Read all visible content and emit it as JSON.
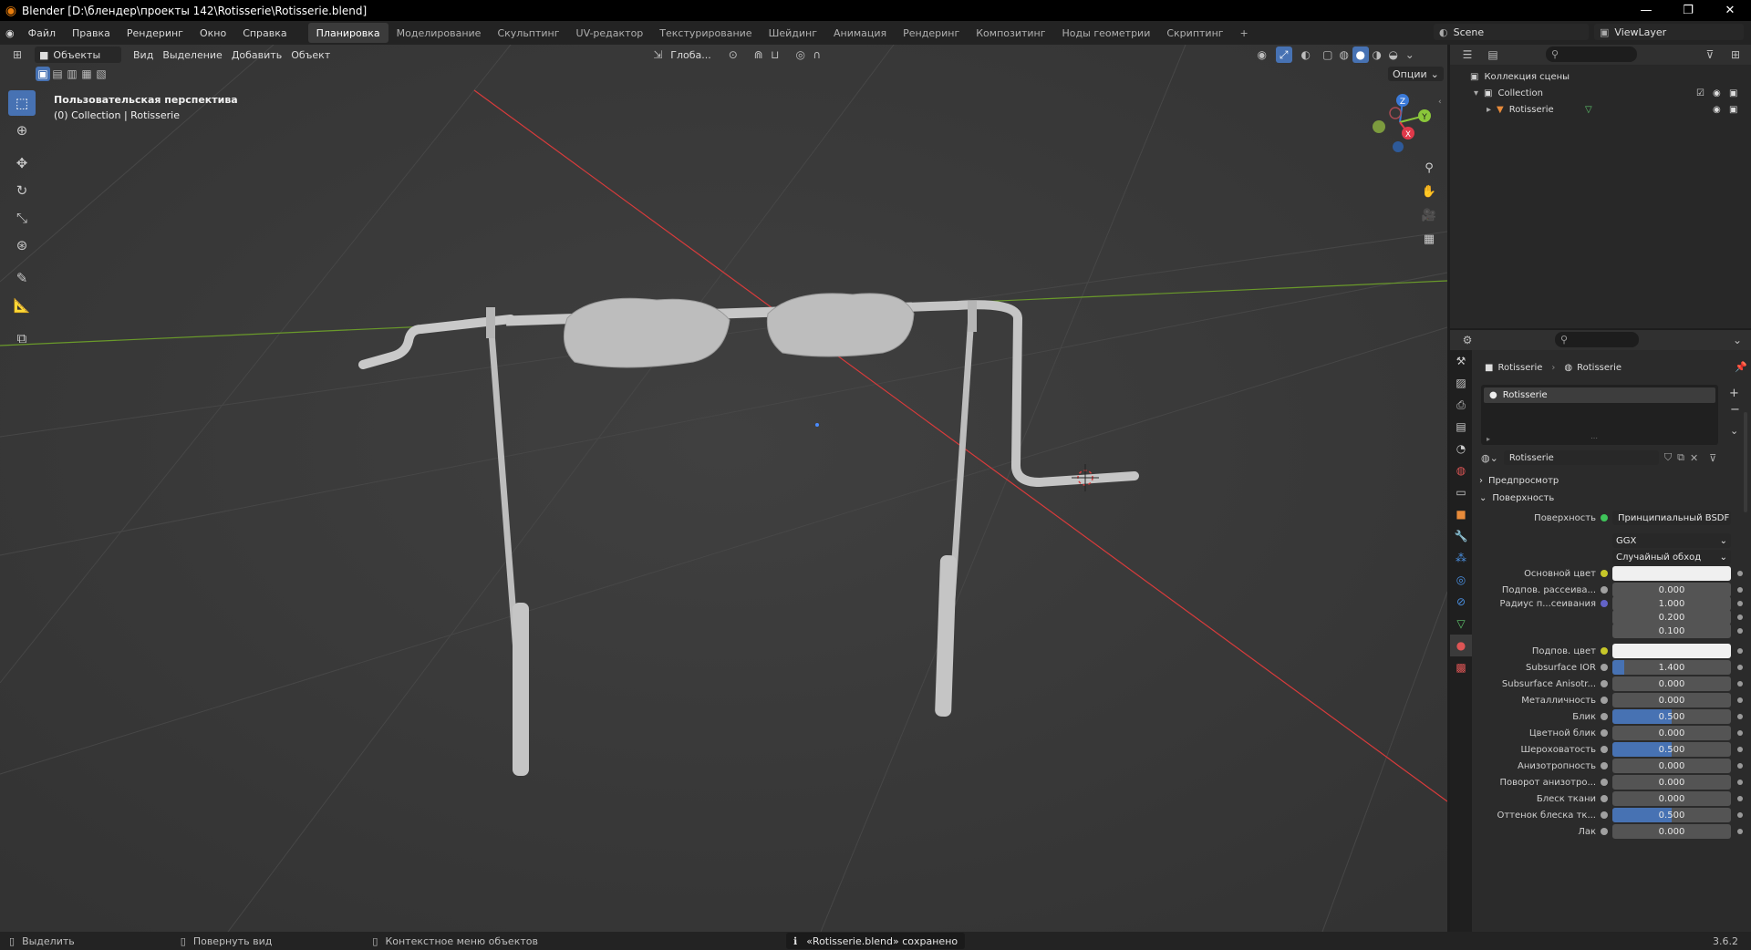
{
  "window": {
    "title": "Blender [D:\\блендер\\проекты 142\\Rotisserie\\Rotisserie.blend]",
    "minimize": "—",
    "maximize": "❐",
    "close": "✕"
  },
  "menu": {
    "file": "Файл",
    "edit": "Правка",
    "render": "Рендеринг",
    "window": "Окно",
    "help": "Справка"
  },
  "workspaces": [
    "Планировка",
    "Моделирование",
    "Скульптинг",
    "UV-редактор",
    "Текстурирование",
    "Шейдинг",
    "Анимация",
    "Рендеринг",
    "Композитинг",
    "Ноды геометрии",
    "Скриптинг",
    "+"
  ],
  "scene": {
    "name": "Scene",
    "view_layer": "ViewLayer"
  },
  "viewport": {
    "mode": "Объекты",
    "menu_view": "Вид",
    "menu_select": "Выделение",
    "menu_add": "Добавить",
    "menu_object": "Объект",
    "orientation": "Глоба...",
    "options": "Опции",
    "info_line1": "Пользовательская перспектива",
    "info_line2": "(0) Collection | Rotisserie",
    "gizmo_x": "X",
    "gizmo_y": "Y",
    "gizmo_z": "Z"
  },
  "outliner": {
    "scene_collection": "Коллекция сцены",
    "collection": "Collection",
    "object": "Rotisserie"
  },
  "properties": {
    "breadcrumb_object": "Rotisserie",
    "breadcrumb_material": "Rotisserie",
    "slot_name": "Rotisserie",
    "material_name": "Rotisserie",
    "panel_preview": "Предпросмотр",
    "panel_surface": "Поверхность",
    "surface_label": "Поверхность",
    "surface_value": "Принципиальный BSDF",
    "distribution": "GGX",
    "subsurface_method": "Случайный обход",
    "fields": [
      {
        "label": "Основной цвет",
        "value": "",
        "type": "color",
        "dot": "yellow"
      },
      {
        "label": "Подпов. рассеива...",
        "value": "0.000",
        "type": "num",
        "dot": "gray"
      },
      {
        "label": "Радиус п...сеивания",
        "value": "1.000",
        "type": "num",
        "dot": "purple"
      },
      {
        "label": "",
        "value": "0.200",
        "type": "num",
        "dot": "none"
      },
      {
        "label": "",
        "value": "0.100",
        "type": "num",
        "dot": "none"
      },
      {
        "label": "Подпов. цвет",
        "value": "",
        "type": "color",
        "dot": "yellow"
      },
      {
        "label": "Subsurface IOR",
        "value": "1.400",
        "type": "num",
        "dot": "gray",
        "fill": 0.1
      },
      {
        "label": "Subsurface Anisotr...",
        "value": "0.000",
        "type": "num",
        "dot": "gray"
      },
      {
        "label": "Металличность",
        "value": "0.000",
        "type": "num",
        "dot": "gray"
      },
      {
        "label": "Блик",
        "value": "0.500",
        "type": "num",
        "dot": "gray",
        "fill": 0.5
      },
      {
        "label": "Цветной блик",
        "value": "0.000",
        "type": "num",
        "dot": "gray"
      },
      {
        "label": "Шероховатость",
        "value": "0.500",
        "type": "num",
        "dot": "gray",
        "fill": 0.5
      },
      {
        "label": "Анизотропность",
        "value": "0.000",
        "type": "num",
        "dot": "gray"
      },
      {
        "label": "Поворот анизотро...",
        "value": "0.000",
        "type": "num",
        "dot": "gray"
      },
      {
        "label": "Блеск ткани",
        "value": "0.000",
        "type": "num",
        "dot": "gray"
      },
      {
        "label": "Оттенок блеска тк...",
        "value": "0.500",
        "type": "num",
        "dot": "gray",
        "fill": 0.5
      },
      {
        "label": "Лак",
        "value": "0.000",
        "type": "num",
        "dot": "gray"
      }
    ]
  },
  "status": {
    "select": "Выделить",
    "rotate_view": "Повернуть вид",
    "context_menu": "Контекстное меню объектов",
    "message": "«Rotisserie.blend» сохранено",
    "version": "3.6.2"
  },
  "colors": {
    "accent": "#4772b3",
    "x_axis": "#d83b3b",
    "y_axis": "#6a9a2a",
    "gizmo_z": "#3b7ad8",
    "gizmo_y": "#8ac63a",
    "gizmo_x": "#e0394a"
  }
}
